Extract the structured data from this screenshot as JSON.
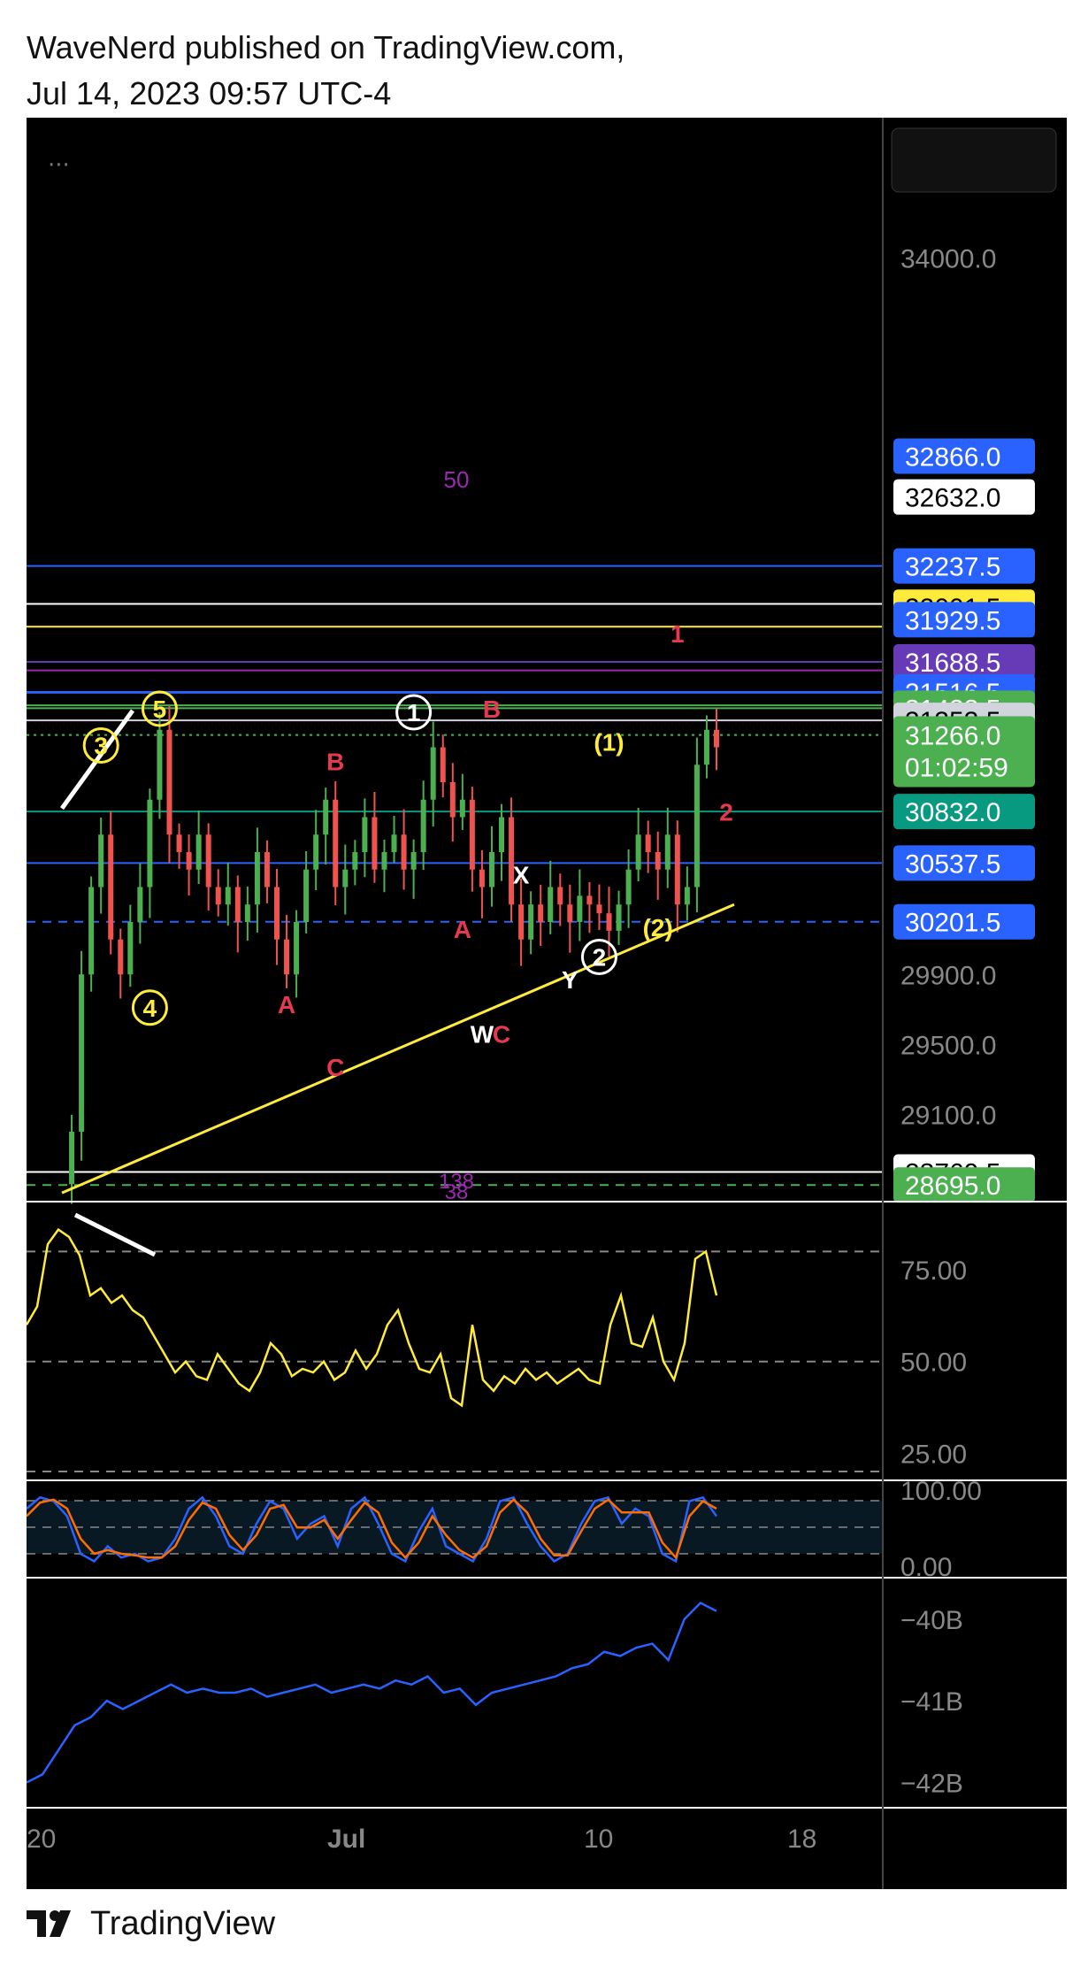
{
  "header": {
    "line1": "WaveNerd published on TradingView.com,",
    "line2": "Jul 14, 2023 09:57 UTC-4"
  },
  "footer": {
    "brand": "TradingView",
    "logo_icon": "tradingview-logo-icon"
  },
  "menu_icon": "more-dots-icon",
  "colors": {
    "background": "#000000",
    "candle_up": "#4caf50",
    "candle_down": "#ef5350",
    "wave_yellow": "#ffeb3b",
    "wave_red": "#e53950",
    "wave_white": "#ffffff",
    "fib_purple": "#9c27b0",
    "rsi_line": "#ffeb3b",
    "stoch_k": "#2962ff",
    "stoch_d": "#ff6d00",
    "obv_line": "#2962ff"
  },
  "chart_data": {
    "type": "candlestick",
    "x_ticks": [
      "20",
      "Jul",
      "10",
      "18"
    ],
    "price_axis": {
      "ticks": [
        "34000.0",
        "29900.0",
        "29500.0",
        "29100.0"
      ],
      "ylim": [
        28600,
        34600
      ]
    },
    "horizontal_levels": [
      {
        "value": 32866.0,
        "label": "32866.0",
        "color": "#2962ff",
        "text_color": "#ffffff",
        "line": false
      },
      {
        "value": 32632.0,
        "label": "32632.0",
        "color": "#ffffff",
        "text_color": "#000000",
        "line": false
      },
      {
        "value": 32237.5,
        "label": "32237.5",
        "color": "#2962ff",
        "text_color": "#ffffff",
        "line": true
      },
      {
        "value": 32001.5,
        "label": "32001.5",
        "color": "#ffeb3b",
        "text_color": "#000000",
        "line": false
      },
      {
        "value": 31929.5,
        "label": "31929.5",
        "color": "#2962ff",
        "text_color": "#ffffff",
        "line": false
      },
      {
        "value": 31688.5,
        "label": "31688.5",
        "color": "#673ab7",
        "text_color": "#ffffff",
        "line": true
      },
      {
        "value": 31516.5,
        "label": "31516.5",
        "color": "#2962ff",
        "text_color": "#ffffff",
        "line": true
      },
      {
        "value": 31423.5,
        "label": "31423.5",
        "color": "#4caf50",
        "text_color": "#ffffff",
        "line": true
      },
      {
        "value": 31353.5,
        "label": "31353.5",
        "color": "#d1d4dc",
        "text_color": "#000000",
        "line": true
      },
      {
        "value": 30832.0,
        "label": "30832.0",
        "color": "#089981",
        "text_color": "#ffffff",
        "line": true
      },
      {
        "value": 30537.5,
        "label": "30537.5",
        "color": "#2962ff",
        "text_color": "#ffffff",
        "line": true
      },
      {
        "value": 30201.5,
        "label": "30201.5",
        "color": "#2962ff",
        "text_color": "#ffffff",
        "line": true,
        "dashed": true
      },
      {
        "value": 28769.5,
        "label": "28769.5",
        "color": "#ffffff",
        "text_color": "#000000",
        "line": true
      },
      {
        "value": 28695.0,
        "label": "28695.0",
        "color": "#4caf50",
        "text_color": "#ffffff",
        "line": true,
        "dashed": true
      }
    ],
    "extra_lines": [
      {
        "value": 32020,
        "color": "#ffffff"
      },
      {
        "value": 31890,
        "color": "#ffeb3b"
      },
      {
        "value": 31640,
        "color": "#9c27b0"
      },
      {
        "value": 31512,
        "color": "#2962ff"
      },
      {
        "value": 31440,
        "color": "#4caf50"
      },
      {
        "value": 31270,
        "color": "#4caf50",
        "dotted": true
      }
    ],
    "current_price": {
      "value": 31266.0,
      "label": "31266.0",
      "countdown": "01:02:59",
      "color": "#4caf50"
    },
    "candles_summary": "approx. 3-hour BTC candles from Jun 20 to Jul 14",
    "price_path": [
      [
        0,
        28700
      ],
      [
        1,
        29000
      ],
      [
        2,
        29900
      ],
      [
        3,
        30400
      ],
      [
        4,
        30700
      ],
      [
        5,
        30100
      ],
      [
        6,
        29900
      ],
      [
        7,
        30200
      ],
      [
        8,
        30400
      ],
      [
        9,
        30900
      ],
      [
        10,
        31300
      ],
      [
        11,
        30700
      ],
      [
        12,
        30600
      ],
      [
        13,
        30500
      ],
      [
        14,
        30700
      ],
      [
        15,
        30400
      ],
      [
        16,
        30300
      ],
      [
        17,
        30400
      ],
      [
        18,
        30200
      ],
      [
        19,
        30300
      ],
      [
        20,
        30600
      ],
      [
        21,
        30400
      ],
      [
        22,
        30100
      ],
      [
        23,
        29900
      ],
      [
        24,
        30200
      ],
      [
        25,
        30500
      ],
      [
        26,
        30700
      ],
      [
        27,
        30900
      ],
      [
        28,
        30400
      ],
      [
        29,
        30500
      ],
      [
        30,
        30600
      ],
      [
        31,
        30800
      ],
      [
        32,
        30500
      ],
      [
        33,
        30600
      ],
      [
        34,
        30700
      ],
      [
        35,
        30500
      ],
      [
        36,
        30600
      ],
      [
        37,
        30900
      ],
      [
        38,
        31200
      ],
      [
        39,
        31000
      ],
      [
        40,
        30800
      ],
      [
        41,
        30900
      ],
      [
        42,
        30500
      ],
      [
        43,
        30400
      ],
      [
        44,
        30600
      ],
      [
        45,
        30800
      ],
      [
        46,
        30300
      ],
      [
        47,
        30100
      ],
      [
        48,
        30300
      ],
      [
        49,
        30200
      ],
      [
        50,
        30400
      ],
      [
        51,
        30300
      ],
      [
        52,
        30200
      ],
      [
        53,
        30350
      ],
      [
        54,
        30300
      ],
      [
        55,
        30250
      ],
      [
        56,
        30150
      ],
      [
        57,
        30300
      ],
      [
        58,
        30500
      ],
      [
        59,
        30700
      ],
      [
        60,
        30600
      ],
      [
        61,
        30500
      ],
      [
        62,
        30700
      ],
      [
        63,
        30300
      ],
      [
        64,
        30400
      ],
      [
        65,
        31100
      ],
      [
        66,
        31300
      ],
      [
        67,
        31200
      ]
    ],
    "wave_labels": [
      {
        "text": "5",
        "color": "#ffeb3b",
        "circled": true,
        "i": 10,
        "price": 31420
      },
      {
        "text": "3",
        "color": "#ffeb3b",
        "circled": true,
        "i": 4,
        "price": 31210
      },
      {
        "text": "4",
        "color": "#ffeb3b",
        "circled": true,
        "i": 9,
        "price": 29710
      },
      {
        "text": "1",
        "color": "#ffffff",
        "circled": true,
        "i": 36,
        "price": 31400
      },
      {
        "text": "2",
        "color": "#ffffff",
        "circled": true,
        "i": 55,
        "price": 30000
      },
      {
        "text": "(1)",
        "color": "#ffeb3b",
        "circled": false,
        "i": 56,
        "price": 31230
      },
      {
        "text": "(2)",
        "color": "#ffeb3b",
        "circled": false,
        "i": 61,
        "price": 30170
      },
      {
        "text": "B",
        "color": "#e53950",
        "circled": false,
        "i": 28,
        "price": 31120
      },
      {
        "text": "A",
        "color": "#e53950",
        "circled": false,
        "i": 23,
        "price": 29730
      },
      {
        "text": "C",
        "color": "#e53950",
        "circled": false,
        "i": 28,
        "price": 29370
      },
      {
        "text": "B",
        "color": "#e53950",
        "circled": false,
        "i": 44,
        "price": 31420
      },
      {
        "text": "A",
        "color": "#e53950",
        "circled": false,
        "i": 41,
        "price": 30160
      },
      {
        "text": "W",
        "color": "#ffffff",
        "circled": false,
        "i": 43,
        "price": 29560
      },
      {
        "text": "C",
        "color": "#e53950",
        "circled": false,
        "i": 45,
        "price": 29560
      },
      {
        "text": "X",
        "color": "#ffffff",
        "circled": false,
        "i": 47,
        "price": 30470
      },
      {
        "text": "Y",
        "color": "#ffffff",
        "circled": false,
        "i": 52,
        "price": 29870
      },
      {
        "text": "1",
        "color": "#e53950",
        "circled": false,
        "i": 63,
        "price": 31850
      },
      {
        "text": "2",
        "color": "#e53950",
        "circled": false,
        "i": 68,
        "price": 30830
      }
    ],
    "fib_labels": [
      {
        "text": "50",
        "color": "#9c27b0"
      },
      {
        "text": "138",
        "color": "#9c27b0"
      },
      {
        "text": "38",
        "color": "#9c27b0"
      }
    ],
    "rsi": {
      "ticks": [
        "75.00",
        "50.00",
        "25.00"
      ],
      "ylim": [
        20,
        90
      ],
      "levels": [
        80,
        50,
        20
      ],
      "values": [
        60,
        65,
        82,
        86,
        84,
        79,
        68,
        70,
        66,
        68,
        64,
        62,
        57,
        52,
        47,
        50,
        46,
        45,
        52,
        48,
        44,
        42,
        47,
        55,
        52,
        46,
        48,
        47,
        50,
        45,
        47,
        53,
        48,
        52,
        60,
        64,
        55,
        48,
        47,
        52,
        40,
        38,
        60,
        45,
        42,
        46,
        44,
        48,
        45,
        47,
        44,
        46,
        48,
        45,
        44,
        60,
        68,
        55,
        54,
        62,
        50,
        45,
        55,
        78,
        80,
        68
      ]
    },
    "stoch": {
      "ticks": [
        "100.00",
        "0.00"
      ],
      "ylim": [
        0,
        100
      ],
      "k": [
        80,
        95,
        90,
        70,
        20,
        10,
        30,
        15,
        20,
        10,
        15,
        40,
        80,
        95,
        70,
        30,
        20,
        60,
        90,
        80,
        40,
        60,
        70,
        30,
        80,
        95,
        60,
        20,
        10,
        50,
        80,
        30,
        20,
        10,
        40,
        90,
        95,
        60,
        30,
        10,
        20,
        60,
        90,
        95,
        60,
        80,
        70,
        20,
        10,
        90,
        95,
        70
      ],
      "d": [
        70,
        88,
        92,
        80,
        40,
        20,
        25,
        20,
        18,
        15,
        15,
        30,
        65,
        88,
        80,
        45,
        25,
        45,
        80,
        85,
        55,
        55,
        65,
        40,
        65,
        88,
        75,
        35,
        15,
        35,
        70,
        45,
        25,
        15,
        30,
        75,
        92,
        75,
        40,
        18,
        18,
        50,
        80,
        92,
        75,
        75,
        75,
        35,
        15,
        70,
        90,
        80
      ]
    },
    "obv": {
      "ticks": [
        "−40B",
        "−41B",
        "−42B"
      ],
      "ylim": [
        -42.2,
        -39.6
      ],
      "values": [
        -42.0,
        -41.9,
        -41.6,
        -41.3,
        -41.2,
        -41.0,
        -41.1,
        -41.0,
        -40.9,
        -40.8,
        -40.9,
        -40.85,
        -40.9,
        -40.9,
        -40.85,
        -40.95,
        -40.9,
        -40.85,
        -40.8,
        -40.9,
        -40.85,
        -40.8,
        -40.85,
        -40.75,
        -40.8,
        -40.7,
        -40.9,
        -40.85,
        -41.05,
        -40.9,
        -40.85,
        -40.8,
        -40.75,
        -40.7,
        -40.6,
        -40.55,
        -40.4,
        -40.45,
        -40.35,
        -40.3,
        -40.5,
        -40.0,
        -39.8,
        -39.9
      ]
    }
  }
}
